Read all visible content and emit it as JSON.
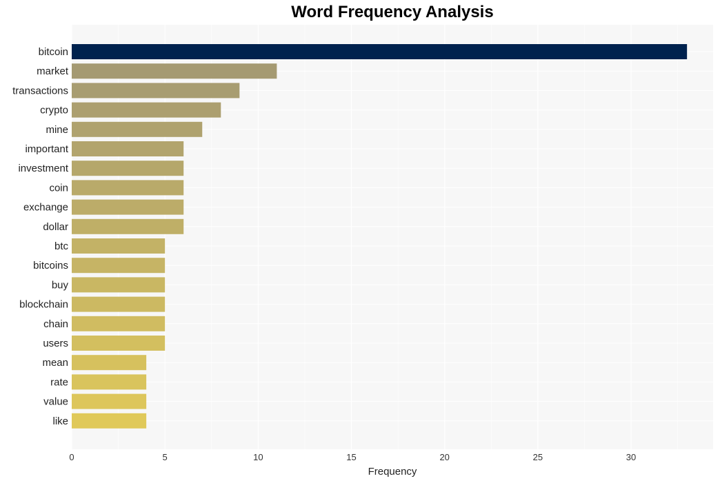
{
  "chart_data": {
    "type": "bar",
    "orientation": "horizontal",
    "title": "Word Frequency Analysis",
    "xlabel": "Frequency",
    "ylabel": "",
    "xlim": [
      0,
      34.4
    ],
    "xticks": [
      0,
      5,
      10,
      15,
      20,
      25,
      30
    ],
    "grid": true,
    "categories": [
      "bitcoin",
      "market",
      "transactions",
      "crypto",
      "mine",
      "important",
      "investment",
      "coin",
      "exchange",
      "dollar",
      "btc",
      "bitcoins",
      "buy",
      "blockchain",
      "chain",
      "users",
      "mean",
      "rate",
      "value",
      "like"
    ],
    "values": [
      33,
      11,
      9,
      8,
      7,
      6,
      6,
      6,
      6,
      6,
      5,
      5,
      5,
      5,
      5,
      5,
      4,
      4,
      4,
      4
    ],
    "colors": {
      "top_bar": "#00224e",
      "gradient_high": "#a59a72",
      "gradient_low": "#e0c95a",
      "plot_background": "#f7f7f7",
      "gridline": "#ffffff"
    }
  }
}
